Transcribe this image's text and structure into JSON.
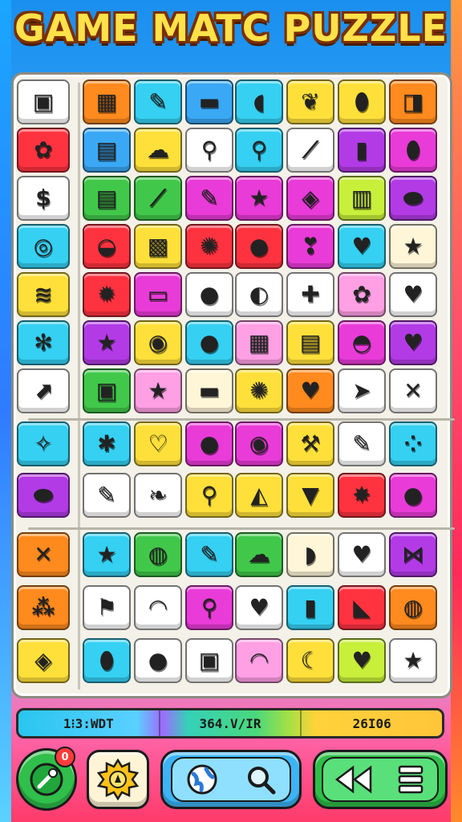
{
  "title": "GAME MATC PUZZLE",
  "status": {
    "left": "1⁝3:WDT",
    "middle": "364.V/IR",
    "right": "26I06"
  },
  "joy_badge": "0",
  "colors": {
    "cyan": "#35d0f2",
    "yellow": "#ffe03a",
    "magenta": "#e93bd8",
    "green": "#41c84a",
    "orange": "#ff8a1e",
    "red": "#ff3340",
    "purple": "#b23be6",
    "cream": "#fff6d8",
    "lime": "#c8ef3a",
    "pink": "#ff9fe4",
    "white": "#ffffff",
    "blue": "#3aa8f5"
  },
  "rows": [
    [
      [
        "white",
        "tv-icon",
        "▣"
      ],
      [
        "orange",
        "crate-icon",
        "▦"
      ],
      [
        "cyan",
        "pencil-icon",
        "✎"
      ],
      [
        "blue",
        "bar-icon",
        "▬"
      ],
      [
        "cyan",
        "fish-icon",
        "◖"
      ],
      [
        "yellow",
        "leaf-icon",
        "❦"
      ],
      [
        "yellow",
        "candy-icon",
        "⬮"
      ],
      [
        "orange",
        "box-icon",
        "◨"
      ]
    ],
    [
      [
        "red",
        "cookie-icon",
        "✿"
      ],
      [
        "blue",
        "radio-icon",
        "▤"
      ],
      [
        "yellow",
        "cloud-icon",
        "☁"
      ],
      [
        "white",
        "balloon-icon",
        "⚲"
      ],
      [
        "cyan",
        "balloon-icon",
        "⚲"
      ],
      [
        "white",
        "slash-icon",
        "⟋"
      ],
      [
        "purple",
        "bottle-icon",
        "▮"
      ],
      [
        "magenta",
        "bottle-icon",
        "⬮"
      ]
    ],
    [
      [
        "white",
        "coin-icon",
        "$"
      ],
      [
        "green",
        "bag-icon",
        "▤"
      ],
      [
        "green",
        "brush-icon",
        "⟋"
      ],
      [
        "magenta",
        "pencil-icon",
        "✎"
      ],
      [
        "magenta",
        "star-icon",
        "★"
      ],
      [
        "magenta",
        "cube-icon",
        "◈"
      ],
      [
        "lime",
        "phone-icon",
        "▥"
      ],
      [
        "purple",
        "capsule-icon",
        "⬬"
      ]
    ],
    [
      [
        "cyan",
        "circle-icon",
        "◎"
      ],
      [
        "red",
        "eye-icon",
        "◒"
      ],
      [
        "yellow",
        "robot-icon",
        "▩"
      ],
      [
        "red",
        "gear-icon",
        "✺"
      ],
      [
        "red",
        "cookie-icon",
        "●"
      ],
      [
        "magenta",
        "pepper-icon",
        "❣"
      ],
      [
        "cyan",
        "heart-icon",
        "♥"
      ],
      [
        "cream",
        "star-icon",
        "★"
      ]
    ],
    [
      [
        "yellow",
        "wave-icon",
        "≋"
      ],
      [
        "red",
        "cookie-icon",
        "✹"
      ],
      [
        "magenta",
        "sign-icon",
        "▭"
      ],
      [
        "white",
        "ball-icon",
        "●"
      ],
      [
        "white",
        "ball-icon",
        "◐"
      ],
      [
        "white",
        "puzzle-icon",
        "✚"
      ],
      [
        "pink",
        "flower-icon",
        "✿"
      ],
      [
        "white",
        "heart-icon",
        "♥"
      ]
    ],
    [
      [
        "cyan",
        "gear-icon",
        "✻"
      ],
      [
        "purple",
        "star-icon",
        "★"
      ],
      [
        "yellow",
        "coin-icon",
        "◉"
      ],
      [
        "cyan",
        "ball-icon",
        "●"
      ],
      [
        "pink",
        "radio-icon",
        "▦"
      ],
      [
        "yellow",
        "card-icon",
        "▤"
      ],
      [
        "magenta",
        "ufo-icon",
        "◓"
      ],
      [
        "purple",
        "heart-icon",
        "♥"
      ]
    ],
    [
      [
        "white",
        "arrow-icon",
        "⬈"
      ],
      [
        "green",
        "bag-icon",
        "▣"
      ],
      [
        "pink",
        "star-icon",
        "★"
      ],
      [
        "cream",
        "bar-icon",
        "▬"
      ],
      [
        "yellow",
        "sun-icon",
        "✺"
      ],
      [
        "orange",
        "heart-icon",
        "♥"
      ],
      [
        "white",
        "tag-icon",
        "➤"
      ],
      [
        "white",
        "close-icon",
        "✕"
      ]
    ],
    [
      [
        "cyan",
        "key-icon",
        "✧"
      ],
      [
        "cyan",
        "splat-icon",
        "✱"
      ],
      [
        "yellow",
        "heart-icon",
        "♡"
      ],
      [
        "magenta",
        "apple-icon",
        "●"
      ],
      [
        "magenta",
        "bottle-icon",
        "◉"
      ],
      [
        "yellow",
        "hammer-icon",
        "⚒"
      ],
      [
        "white",
        "pencil-icon",
        "✎"
      ],
      [
        "cyan",
        "cluster-icon",
        "⁘"
      ]
    ],
    [
      [
        "purple",
        "capsule-icon",
        "⬬"
      ],
      [
        "white",
        "carrot-icon",
        "✎"
      ],
      [
        "white",
        "leaf-icon",
        "❧"
      ],
      [
        "yellow",
        "lollipop-icon",
        "⚲"
      ],
      [
        "yellow",
        "cake-icon",
        "◭"
      ],
      [
        "yellow",
        "cone-icon",
        "▼"
      ],
      [
        "red",
        "splat-icon",
        "✸"
      ],
      [
        "magenta",
        "plum-icon",
        "●"
      ]
    ],
    [
      [
        "orange",
        "close-icon",
        "✕"
      ],
      [
        "cyan",
        "star-icon",
        "★"
      ],
      [
        "green",
        "lamp-icon",
        "◍"
      ],
      [
        "cyan",
        "pencil-icon",
        "✎"
      ],
      [
        "green",
        "blob-icon",
        "☁"
      ],
      [
        "cream",
        "cloud-icon",
        "◗"
      ],
      [
        "white",
        "heart-icon",
        "♥"
      ],
      [
        "purple",
        "bowtie-icon",
        "⋈"
      ]
    ],
    [
      [
        "orange",
        "stamp-icon",
        "⁂"
      ],
      [
        "white",
        "flag-icon",
        "⚑"
      ],
      [
        "white",
        "lips-icon",
        "◠"
      ],
      [
        "magenta",
        "lollipop-icon",
        "⚲"
      ],
      [
        "white",
        "heart-icon",
        "♥"
      ],
      [
        "cyan",
        "jar-icon",
        "▮"
      ],
      [
        "red",
        "wedge-icon",
        "◣"
      ],
      [
        "orange",
        "chat-icon",
        "◍"
      ]
    ],
    [
      [
        "yellow",
        "box-icon",
        "◈"
      ],
      [
        "cyan",
        "candy-icon",
        "⬮"
      ],
      [
        "white",
        "apple-icon",
        "●"
      ],
      [
        "white",
        "card-icon",
        "▣"
      ],
      [
        "pink",
        "lips-icon",
        "◠"
      ],
      [
        "yellow",
        "moon-icon",
        "☾"
      ],
      [
        "lime",
        "heart-icon",
        "♥"
      ],
      [
        "white",
        "star-icon",
        "★"
      ]
    ]
  ]
}
